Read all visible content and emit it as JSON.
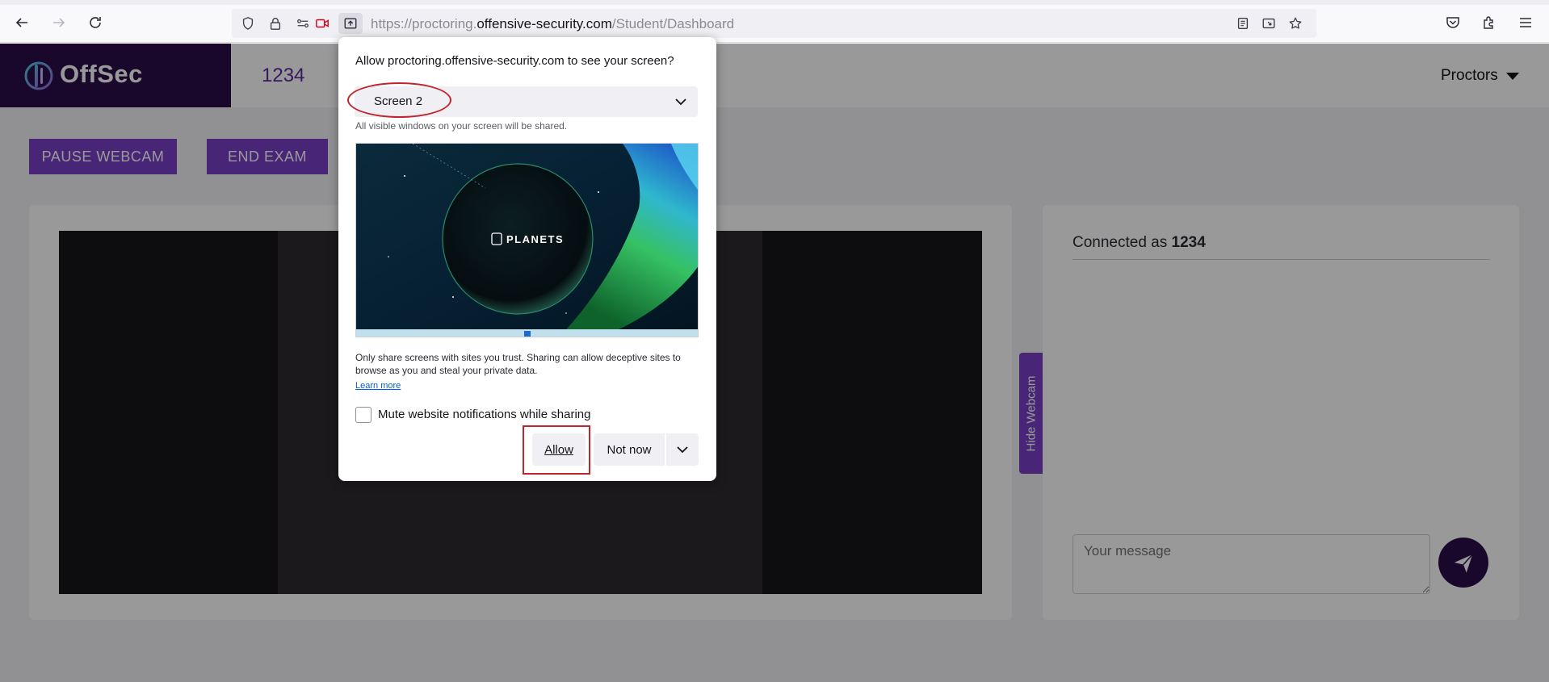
{
  "browser": {
    "url_prefix": "https://proctoring.",
    "url_domain": "offensive-security.com",
    "url_path": "/Student/Dashboard"
  },
  "page": {
    "logo_text": "OffSec",
    "header_id": "1234",
    "proctors_label": "Proctors",
    "pause_webcam": "PAUSE WEBCAM",
    "end_exam": "END EXAM",
    "connected_prefix": "Connected as ",
    "connected_user": "1234",
    "message_placeholder": "Your message",
    "hide_webcam": "Hide Webcam"
  },
  "dialog": {
    "title": "Allow proctoring.offensive-security.com to see your screen?",
    "selected_screen": "Screen 2",
    "hint": "All visible windows on your screen will be shared.",
    "preview_brand": "PLANETS",
    "warning": "Only share screens with sites you trust. Sharing can allow deceptive sites to browse as you and steal your private data.",
    "learn_more": "Learn more",
    "mute_label": "Mute website notifications while sharing",
    "allow": "Allow",
    "not_now": "Not now"
  },
  "colors": {
    "brand_dark": "#2a0e4a",
    "brand_purple": "#7b3fc8",
    "highlight_red": "#c0252f"
  }
}
